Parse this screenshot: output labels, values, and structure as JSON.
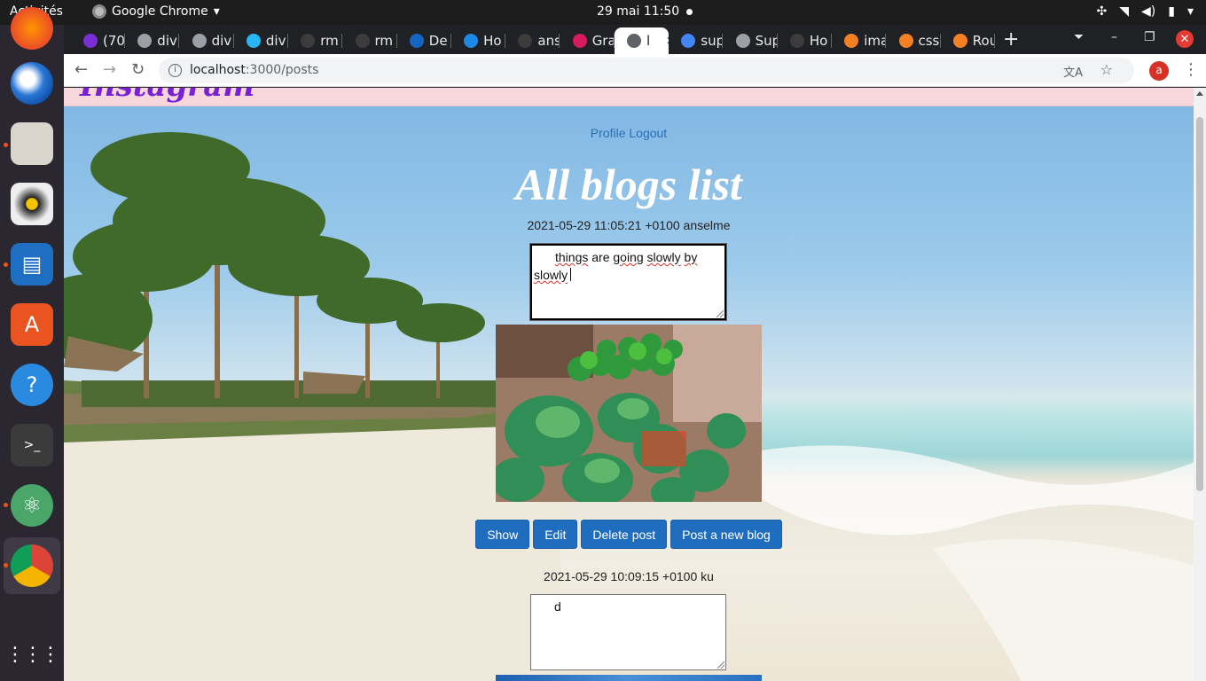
{
  "topbar": {
    "activities": "Activités",
    "app_name": "Google Chrome",
    "clock": "29 mai  11:50"
  },
  "dock": {
    "apps": [
      "firefox-icon",
      "thunderbird-icon",
      "files-icon",
      "rhythmbox-icon",
      "libreoffice-impress-icon",
      "ubuntu-software-icon",
      "help-icon",
      "terminal-icon",
      "atom-icon",
      "chrome-icon",
      "app-grid-icon"
    ]
  },
  "tabs": [
    {
      "label": "(70",
      "color": "#7b2ed6"
    },
    {
      "label": "div",
      "color": "#9aa0a6"
    },
    {
      "label": "div",
      "color": "#9aa0a6"
    },
    {
      "label": "div",
      "color": "#29b6f6"
    },
    {
      "label": "rm",
      "color": "#3c3c3c"
    },
    {
      "label": "rm",
      "color": "#3c3c3c"
    },
    {
      "label": "De",
      "color": "#1565c0"
    },
    {
      "label": "Ho",
      "color": "#1e88e5"
    },
    {
      "label": "ans",
      "color": "#3c3c3c"
    },
    {
      "label": "Gra",
      "color": "#d81b60"
    },
    {
      "label": "l",
      "color": "#5f6368",
      "active": true
    },
    {
      "label": "sup",
      "color": "#4285f4"
    },
    {
      "label": "Sup",
      "color": "#9aa0a6"
    },
    {
      "label": "Ho",
      "color": "#3c3c3c"
    },
    {
      "label": "ima",
      "color": "#f48024"
    },
    {
      "label": "css",
      "color": "#f48024"
    },
    {
      "label": "Rou",
      "color": "#f48024"
    }
  ],
  "toolbar": {
    "url_host": "localhost",
    "url_path": ":3000/posts",
    "profile_initial": "a"
  },
  "site": {
    "brand": "Instagram",
    "nav_profile": "Profile",
    "nav_logout": "Logout",
    "title": "All blogs list"
  },
  "posts": [
    {
      "meta": "2021-05-29 11:05:21 +0100 anselme",
      "body_words": [
        "things",
        "are",
        "going",
        "slowly",
        "by",
        "slowly"
      ],
      "buttons": {
        "show": "Show",
        "edit": "Edit",
        "delete": "Delete post",
        "new": "Post a new blog"
      }
    },
    {
      "meta": "2021-05-29 10:09:15 +0100 ku",
      "body": "d"
    }
  ],
  "colors": {
    "button": "#1f6dbf",
    "link": "#2a6db5",
    "header_bg": "#f8d7dc",
    "brand": "#7a1fd8"
  }
}
